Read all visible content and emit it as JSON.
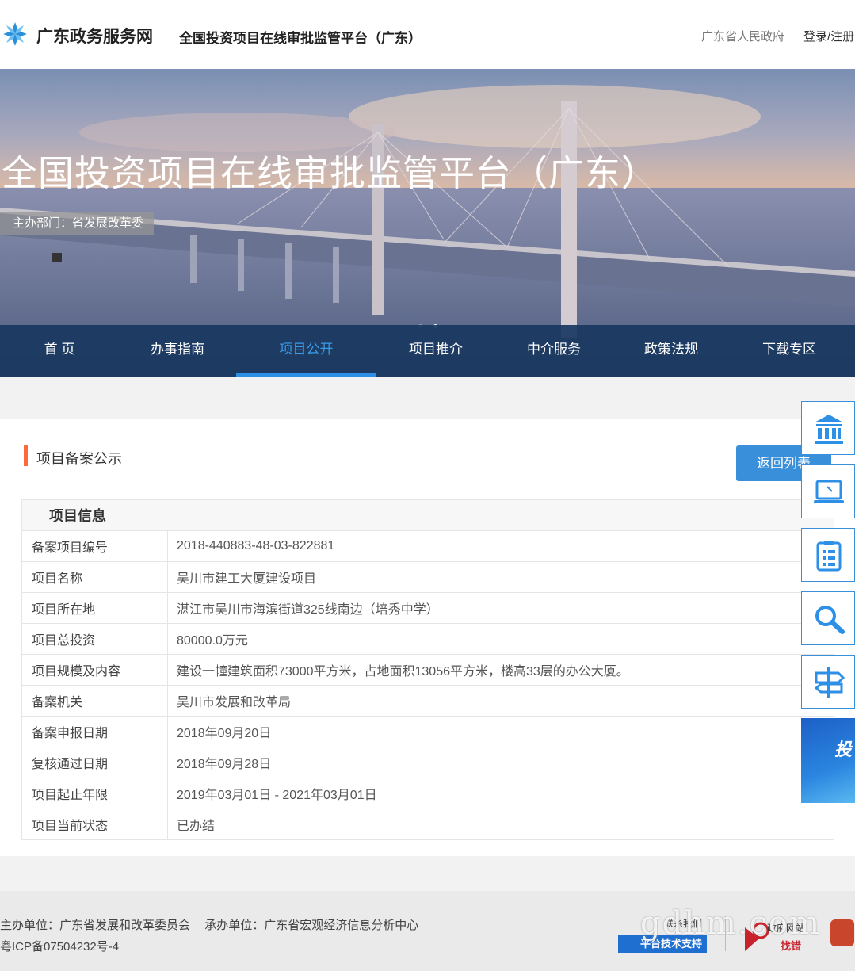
{
  "header": {
    "site_name": "广东政务服务网",
    "platform_name": "全国投资项目在线审批监管平台（广东）",
    "gov_link": "广东省人民政府",
    "login": "登录/注册"
  },
  "banner": {
    "title": "全国投资项目在线审批监管平台（广东）",
    "dept": "主办部门：省发展改革委"
  },
  "nav": {
    "items": [
      {
        "label": "首 页"
      },
      {
        "label": "办事指南"
      },
      {
        "label": "项目公开"
      },
      {
        "label": "项目推介"
      },
      {
        "label": "中介服务"
      },
      {
        "label": "政策法规"
      },
      {
        "label": "下载专区"
      }
    ],
    "active": "项目公开"
  },
  "card": {
    "title": "项目备案公示",
    "back_label": "返回列表",
    "table_title": "项目信息",
    "rows": [
      {
        "key": "备案项目编号",
        "value": "2018-440883-48-03-822881"
      },
      {
        "key": "项目名称",
        "value": "吴川市建工大厦建设项目"
      },
      {
        "key": "项目所在地",
        "value": "湛江市吴川市海滨街道325线南边（培秀中学）"
      },
      {
        "key": "项目总投资",
        "value": "80000.0万元"
      },
      {
        "key": "项目规模及内容",
        "value": "建设一幢建筑面积73000平方米，占地面积13056平方米，楼高33层的办公大厦。"
      },
      {
        "key": "备案机关",
        "value": "吴川市发展和改革局"
      },
      {
        "key": "备案申报日期",
        "value": "2018年09月20日"
      },
      {
        "key": "复核通过日期",
        "value": "2018年09月28日"
      },
      {
        "key": "项目起止年限",
        "value": "2019年03月01日 - 2021年03月01日"
      },
      {
        "key": "项目当前状态",
        "value": "已办结"
      }
    ]
  },
  "side_ad": {
    "text": "投"
  },
  "footer": {
    "host_label": "主办单位：广东省发展和改革委员会",
    "org_label": "承办单位：广东省宏观经济信息分析中心",
    "icp": "粤ICP备07504232号-4",
    "tech_top": "联系我们",
    "tech_support": "平台技术支持",
    "err_top": "政府网站",
    "err_text": "找错",
    "watermark": "gdhm.com"
  },
  "colors": {
    "accent": "#3a8fdb",
    "nav_bg": "#19375f",
    "marker": "#ff6a3d"
  }
}
